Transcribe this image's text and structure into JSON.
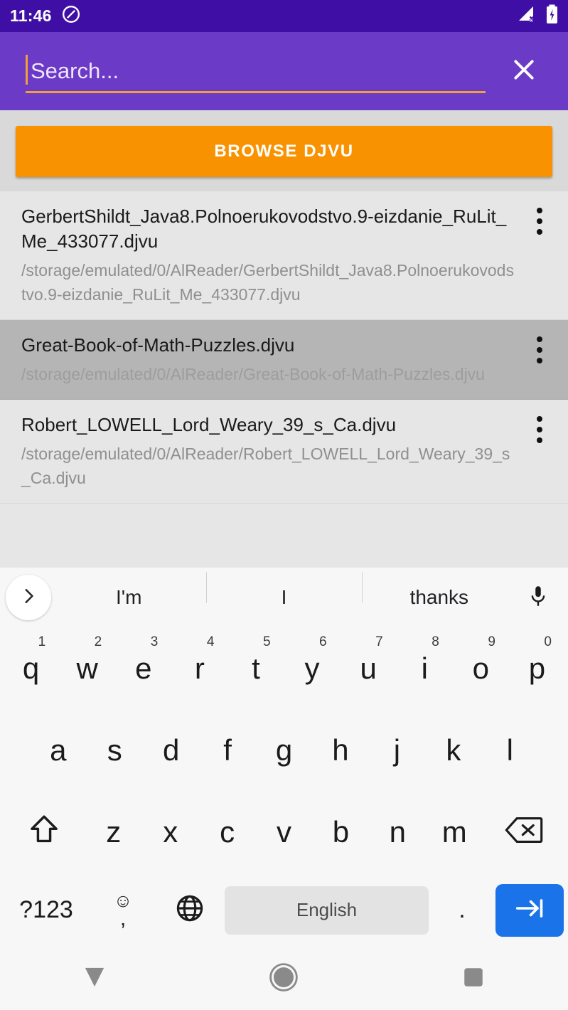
{
  "status_bar": {
    "time": "11:46",
    "left_icon": "dnd-icon",
    "signal_icon": "signal-no-sim-icon",
    "battery_icon": "battery-charging-icon",
    "background_color": "#3f0fa5"
  },
  "app_bar": {
    "background_color": "#6b3ac7",
    "accent_color": "#f2a03a",
    "search_value": "",
    "search_placeholder": "Search...",
    "close_label": "close-icon"
  },
  "main": {
    "browse_button_label": "BROWSE DJVU",
    "browse_button_color": "#f99200",
    "files": [
      {
        "name": "GerbertShildt_Java8.Polnoerukovodstvo.9-eizdanie_RuLit_Me_433077.djvu",
        "path": "/storage/emulated/0/AlReader/GerbertShildt_Java8.Polnoerukovodstvo.9-eizdanie_RuLit_Me_433077.djvu",
        "selected": false
      },
      {
        "name": "Great-Book-of-Math-Puzzles.djvu",
        "path": "/storage/emulated/0/AlReader/Great-Book-of-Math-Puzzles.djvu",
        "selected": true
      },
      {
        "name": "Robert_LOWELL_Lord_Weary_39_s_Ca.djvu",
        "path": "/storage/emulated/0/AlReader/Robert_LOWELL_Lord_Weary_39_s_Ca.djvu",
        "selected": false
      }
    ]
  },
  "keyboard": {
    "suggestions": [
      "I'm",
      "I",
      "thanks"
    ],
    "expand_icon": "chevron-right-icon",
    "mic_icon": "microphone-icon",
    "row1": [
      {
        "key": "q",
        "num": "1"
      },
      {
        "key": "w",
        "num": "2"
      },
      {
        "key": "e",
        "num": "3"
      },
      {
        "key": "r",
        "num": "4"
      },
      {
        "key": "t",
        "num": "5"
      },
      {
        "key": "y",
        "num": "6"
      },
      {
        "key": "u",
        "num": "7"
      },
      {
        "key": "i",
        "num": "8"
      },
      {
        "key": "o",
        "num": "9"
      },
      {
        "key": "p",
        "num": "0"
      }
    ],
    "row2": [
      "a",
      "s",
      "d",
      "f",
      "g",
      "h",
      "j",
      "k",
      "l"
    ],
    "row3": [
      "z",
      "x",
      "c",
      "v",
      "b",
      "n",
      "m"
    ],
    "shift_icon": "shift-arrow-icon",
    "backspace_icon": "backspace-icon",
    "symbols_label": "?123",
    "emoji_icon": "emoji-smiley-icon",
    "comma_label": ",",
    "globe_icon": "language-globe-icon",
    "space_label": "English",
    "period_label": ".",
    "enter_icon": "next-field-arrow-icon",
    "enter_color": "#1a73e8"
  },
  "nav_bar": {
    "back_icon": "back-down-triangle-icon",
    "home_icon": "home-circle-icon",
    "recents_icon": "recents-square-icon"
  }
}
